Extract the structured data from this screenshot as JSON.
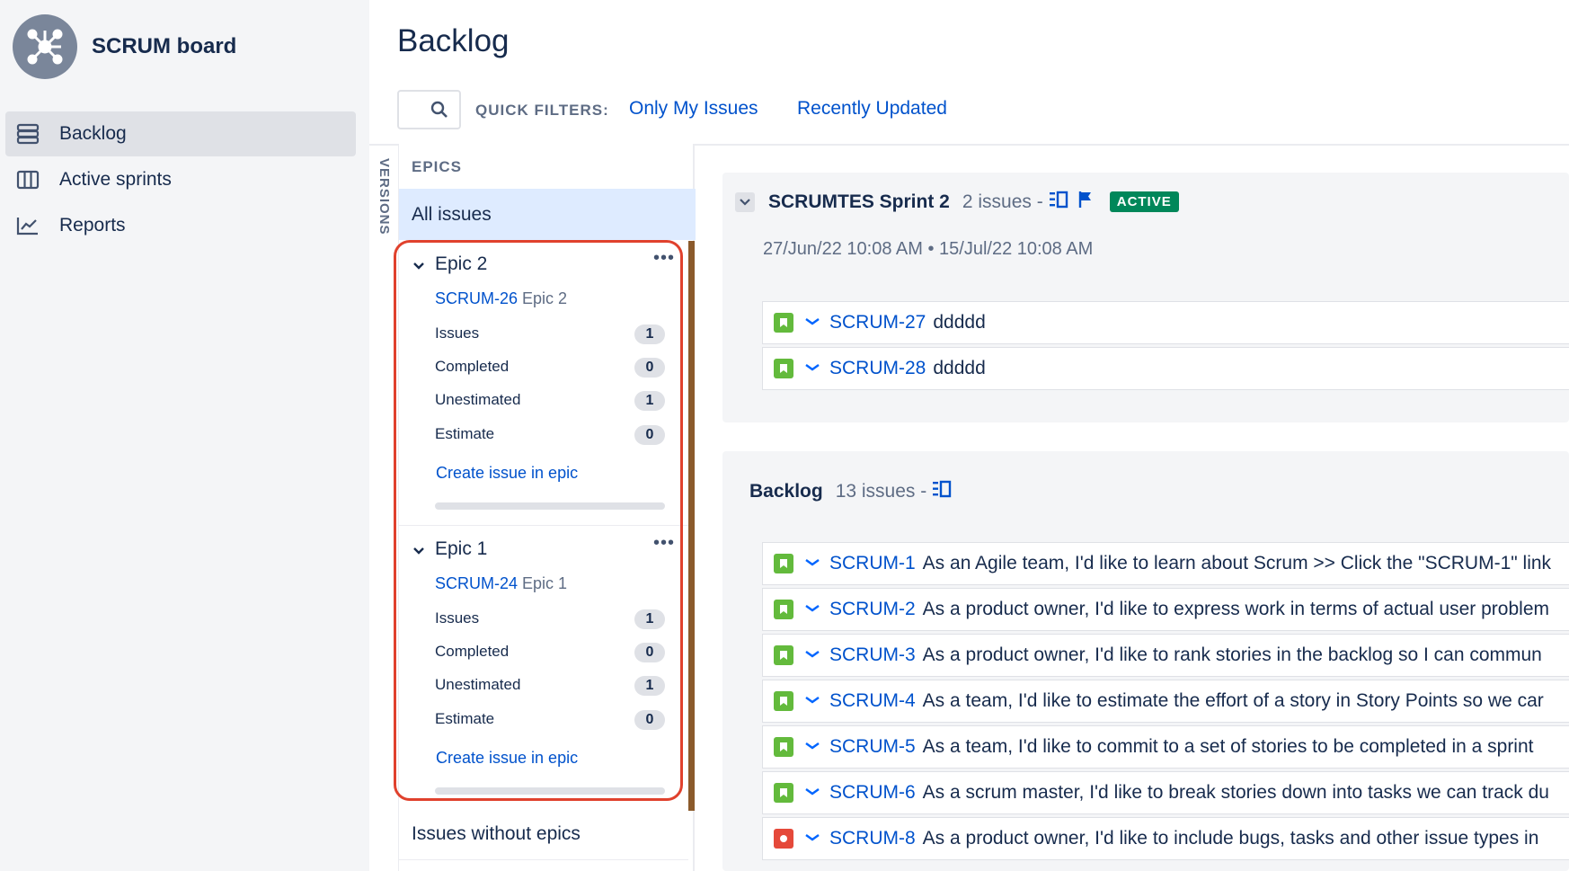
{
  "sidebar": {
    "project_name": "SCRUM board",
    "items": [
      {
        "label": "Backlog",
        "icon": "backlog-icon",
        "active": true
      },
      {
        "label": "Active sprints",
        "icon": "board-columns-icon",
        "active": false
      },
      {
        "label": "Reports",
        "icon": "chart-line-icon",
        "active": false
      }
    ]
  },
  "header": {
    "title": "Backlog",
    "quick_filters_label": "QUICK FILTERS:",
    "filters": [
      "Only My Issues",
      "Recently Updated"
    ]
  },
  "versions_tab": "VERSIONS",
  "epics_panel": {
    "heading": "EPICS",
    "all_issues": "All issues",
    "epics": [
      {
        "name": "Epic 2",
        "key": "SCRUM-26",
        "key_name": "Epic 2",
        "stats": [
          {
            "label": "Issues",
            "value": "1"
          },
          {
            "label": "Completed",
            "value": "0"
          },
          {
            "label": "Unestimated",
            "value": "1"
          },
          {
            "label": "Estimate",
            "value": "0"
          }
        ],
        "create_label": "Create issue in epic",
        "more": "•••"
      },
      {
        "name": "Epic 1",
        "key": "SCRUM-24",
        "key_name": "Epic 1",
        "stats": [
          {
            "label": "Issues",
            "value": "1"
          },
          {
            "label": "Completed",
            "value": "0"
          },
          {
            "label": "Unestimated",
            "value": "1"
          },
          {
            "label": "Estimate",
            "value": "0"
          }
        ],
        "create_label": "Create issue in epic",
        "more": "•••"
      }
    ],
    "issues_without_epics": "Issues without epics"
  },
  "sprint": {
    "name": "SCRUMTES Sprint 2",
    "count": "2 issues -",
    "status": "ACTIVE",
    "dates": "27/Jun/22 10:08 AM  •  15/Jul/22 10:08 AM",
    "issues": [
      {
        "key": "SCRUM-27",
        "summary": "ddddd",
        "type": "story"
      },
      {
        "key": "SCRUM-28",
        "summary": "ddddd",
        "type": "story"
      }
    ]
  },
  "backlog": {
    "name": "Backlog",
    "count": "13 issues -",
    "issues": [
      {
        "key": "SCRUM-1",
        "summary": "As an Agile team, I'd like to learn about Scrum >> Click the \"SCRUM-1\" link",
        "type": "story"
      },
      {
        "key": "SCRUM-2",
        "summary": "As a product owner, I'd like to express work in terms of actual user problem",
        "type": "story"
      },
      {
        "key": "SCRUM-3",
        "summary": "As a product owner, I'd like to rank stories in the backlog so I can commun",
        "type": "story"
      },
      {
        "key": "SCRUM-4",
        "summary": "As a team, I'd like to estimate the effort of a story in Story Points so we car",
        "type": "story"
      },
      {
        "key": "SCRUM-5",
        "summary": "As a team, I'd like to commit to a set of stories to be completed in a sprint",
        "type": "story"
      },
      {
        "key": "SCRUM-6",
        "summary": "As a scrum master, I'd like to break stories down into tasks we can track du",
        "type": "story"
      },
      {
        "key": "SCRUM-8",
        "summary": "As a product owner, I'd like to include bugs, tasks and other issue types in",
        "type": "bug"
      }
    ]
  },
  "colors": {
    "story": "#63ba3c",
    "bug": "#e5493a",
    "link": "#0052cc",
    "active_badge": "#00875a",
    "highlight": "#e0412d"
  }
}
